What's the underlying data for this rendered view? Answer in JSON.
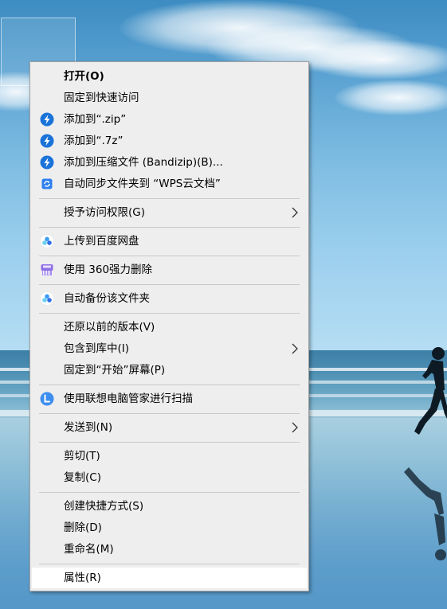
{
  "context_menu": {
    "items": [
      {
        "label": "打开(O)"
      },
      {
        "label": "固定到快速访问"
      },
      {
        "label": "添加到“.zip”",
        "icon": "bandizip-icon"
      },
      {
        "label": "添加到“.7z”",
        "icon": "bandizip-icon"
      },
      {
        "label": "添加到压缩文件 (Bandizip)(B)...",
        "icon": "bandizip-icon"
      },
      {
        "label": "自动同步文件夹到 “WPS云文档”",
        "icon": "wps-cloud-icon"
      },
      {
        "label": "授予访问权限(G)"
      },
      {
        "label": "上传到百度网盘",
        "icon": "baidu-netdisk-icon"
      },
      {
        "label": "使用 360强力删除",
        "icon": "360-shredder-icon"
      },
      {
        "label": "自动备份该文件夹",
        "icon": "baidu-netdisk-icon"
      },
      {
        "label": "还原以前的版本(V)"
      },
      {
        "label": "包含到库中(I)"
      },
      {
        "label": "固定到“开始”屏幕(P)"
      },
      {
        "label": "使用联想电脑管家进行扫描",
        "icon": "lenovo-manager-icon"
      },
      {
        "label": "发送到(N)"
      },
      {
        "label": "剪切(T)"
      },
      {
        "label": "复制(C)"
      },
      {
        "label": "创建快捷方式(S)"
      },
      {
        "label": "删除(D)"
      },
      {
        "label": "重命名(M)"
      },
      {
        "label": "属性(R)"
      }
    ]
  },
  "colors": {
    "menu_background": "#eeeeee",
    "bandizip_blue": "#1a73d9",
    "hover_background": "#ffffff"
  }
}
